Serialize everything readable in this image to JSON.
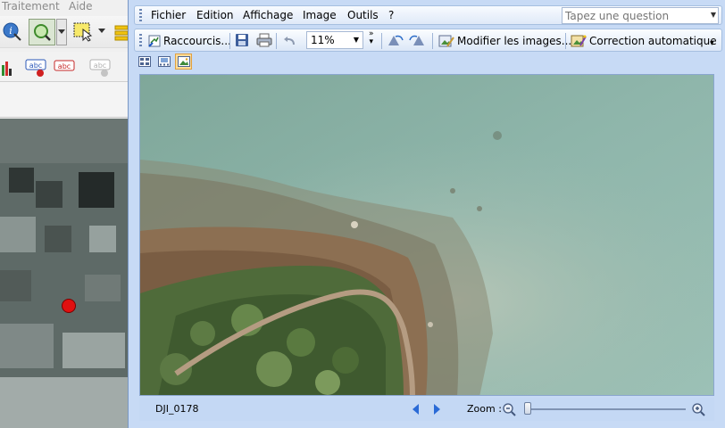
{
  "background_app": {
    "menu": [
      "Traitement",
      "Aide"
    ],
    "toolbar_icons": [
      "identify-icon",
      "zoom-icon",
      "dropdown-arrow-icon",
      "select-icon",
      "dropdown-arrow-icon",
      "layers-icon"
    ],
    "label_icons": [
      "histogram-icon",
      "label-abc-icon",
      "label-abc-red-icon",
      "label-abc-gray-icon"
    ],
    "map_marker_color": "#e01010"
  },
  "viewer": {
    "menu": {
      "fichier": "Fichier",
      "edition": "Edition",
      "affichage": "Affichage",
      "image": "Image",
      "outils": "Outils",
      "help": "?"
    },
    "ask_placeholder": "Tapez une question",
    "toolbar": {
      "shortcuts_label": "Raccourcis...",
      "zoom_value": "11%",
      "edit_images_label": "Modifier les images...",
      "autocorrect_label": "Correction automatique"
    },
    "view_modes": [
      "thumbnail-view-icon",
      "filmstrip-view-icon",
      "single-image-view-icon"
    ],
    "status": {
      "file_name": "DJI_0178",
      "zoom_label": "Zoom :"
    },
    "zoom_slider_level": 0.0
  },
  "colors": {
    "window_bg": "#c7daf5",
    "status_bg": "#c4d8f4",
    "active_view": "#fddc9a",
    "nav_arrow": "#2a6ad6"
  }
}
